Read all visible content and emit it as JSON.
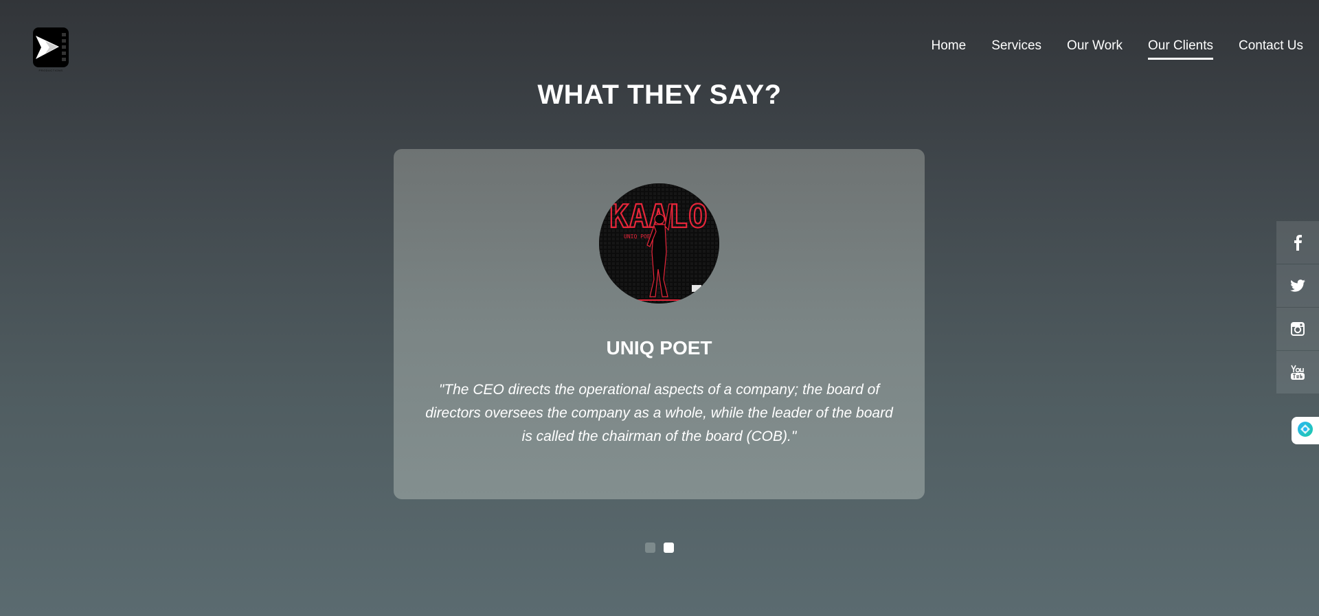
{
  "logo": {
    "name": "play-logo-icon",
    "tagline": "PRODUCTIONS"
  },
  "nav": {
    "items": [
      {
        "label": "Home"
      },
      {
        "label": "Services"
      },
      {
        "label": "Our Work"
      },
      {
        "label": "Our Clients",
        "active": true
      },
      {
        "label": "Contact Us"
      }
    ]
  },
  "section": {
    "title": "WHAT THEY SAY?"
  },
  "testimonial": {
    "avatar_text": {
      "title": "KAALO",
      "subtitle": "UNIQ POET"
    },
    "name": "UNIQ POET",
    "quote": "\"The CEO directs the operational aspects of a company; the board of directors oversees the company as a whole, while the leader of the board is called the chairman of the board (COB).\""
  },
  "pagination": {
    "total": 2,
    "active_index": 1
  },
  "social": [
    {
      "icon": "facebook-icon"
    },
    {
      "icon": "twitter-icon"
    },
    {
      "icon": "instagram-icon"
    },
    {
      "icon": "youtube-icon"
    }
  ],
  "widget": {
    "icon": "chat-widget-icon"
  },
  "colors": {
    "accent": "#ffffff",
    "neon": "#e8263a",
    "card_top": "#6e7373",
    "card_bottom": "#838f8f"
  }
}
